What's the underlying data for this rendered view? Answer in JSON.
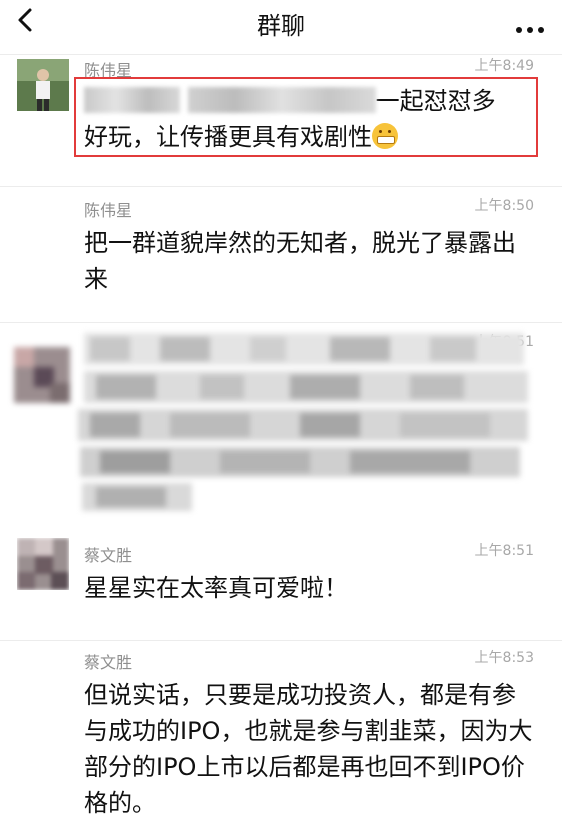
{
  "header": {
    "title": "群聊"
  },
  "messages": [
    {
      "name": "陈伟星",
      "time": "上午8:49",
      "text_visible": "一起怼怼多好玩，让传播更具有戏剧性"
    },
    {
      "name": "陈伟星",
      "time": "上午8:50",
      "text": "把一群道貌岸然的无知者，脱光了暴露出来"
    },
    {
      "name": "",
      "time": "上午8:51",
      "text": ""
    },
    {
      "name": "蔡文胜",
      "time": "上午8:51",
      "text": "星星实在太率真可爱啦！"
    },
    {
      "name": "蔡文胜",
      "time": "上午8:53",
      "text": "但说实话，只要是成功投资人，都是有参与成功的IPO，也就是参与割韭菜，因为大部分的IPO上市以后都是再也回不到IPO价格的。"
    }
  ],
  "colors": {
    "highlight": "#e23b3b",
    "name": "#8f8f8f",
    "time": "#a8a8a8"
  }
}
